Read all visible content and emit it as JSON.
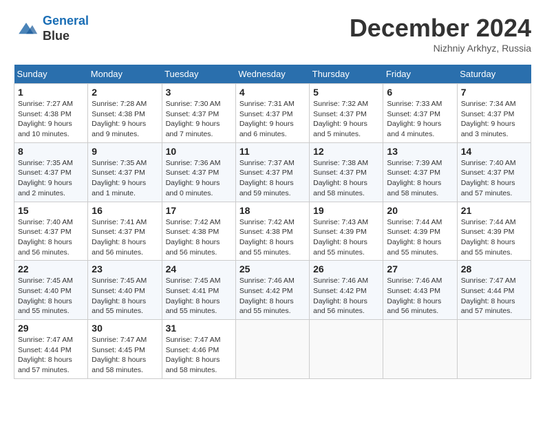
{
  "header": {
    "logo_line1": "General",
    "logo_line2": "Blue",
    "month": "December 2024",
    "location": "Nizhniy Arkhyz, Russia"
  },
  "weekdays": [
    "Sunday",
    "Monday",
    "Tuesday",
    "Wednesday",
    "Thursday",
    "Friday",
    "Saturday"
  ],
  "weeks": [
    [
      {
        "day": "1",
        "sunrise": "Sunrise: 7:27 AM",
        "sunset": "Sunset: 4:38 PM",
        "daylight": "Daylight: 9 hours and 10 minutes."
      },
      {
        "day": "2",
        "sunrise": "Sunrise: 7:28 AM",
        "sunset": "Sunset: 4:38 PM",
        "daylight": "Daylight: 9 hours and 9 minutes."
      },
      {
        "day": "3",
        "sunrise": "Sunrise: 7:30 AM",
        "sunset": "Sunset: 4:37 PM",
        "daylight": "Daylight: 9 hours and 7 minutes."
      },
      {
        "day": "4",
        "sunrise": "Sunrise: 7:31 AM",
        "sunset": "Sunset: 4:37 PM",
        "daylight": "Daylight: 9 hours and 6 minutes."
      },
      {
        "day": "5",
        "sunrise": "Sunrise: 7:32 AM",
        "sunset": "Sunset: 4:37 PM",
        "daylight": "Daylight: 9 hours and 5 minutes."
      },
      {
        "day": "6",
        "sunrise": "Sunrise: 7:33 AM",
        "sunset": "Sunset: 4:37 PM",
        "daylight": "Daylight: 9 hours and 4 minutes."
      },
      {
        "day": "7",
        "sunrise": "Sunrise: 7:34 AM",
        "sunset": "Sunset: 4:37 PM",
        "daylight": "Daylight: 9 hours and 3 minutes."
      }
    ],
    [
      {
        "day": "8",
        "sunrise": "Sunrise: 7:35 AM",
        "sunset": "Sunset: 4:37 PM",
        "daylight": "Daylight: 9 hours and 2 minutes."
      },
      {
        "day": "9",
        "sunrise": "Sunrise: 7:35 AM",
        "sunset": "Sunset: 4:37 PM",
        "daylight": "Daylight: 9 hours and 1 minute."
      },
      {
        "day": "10",
        "sunrise": "Sunrise: 7:36 AM",
        "sunset": "Sunset: 4:37 PM",
        "daylight": "Daylight: 9 hours and 0 minutes."
      },
      {
        "day": "11",
        "sunrise": "Sunrise: 7:37 AM",
        "sunset": "Sunset: 4:37 PM",
        "daylight": "Daylight: 8 hours and 59 minutes."
      },
      {
        "day": "12",
        "sunrise": "Sunrise: 7:38 AM",
        "sunset": "Sunset: 4:37 PM",
        "daylight": "Daylight: 8 hours and 58 minutes."
      },
      {
        "day": "13",
        "sunrise": "Sunrise: 7:39 AM",
        "sunset": "Sunset: 4:37 PM",
        "daylight": "Daylight: 8 hours and 58 minutes."
      },
      {
        "day": "14",
        "sunrise": "Sunrise: 7:40 AM",
        "sunset": "Sunset: 4:37 PM",
        "daylight": "Daylight: 8 hours and 57 minutes."
      }
    ],
    [
      {
        "day": "15",
        "sunrise": "Sunrise: 7:40 AM",
        "sunset": "Sunset: 4:37 PM",
        "daylight": "Daylight: 8 hours and 56 minutes."
      },
      {
        "day": "16",
        "sunrise": "Sunrise: 7:41 AM",
        "sunset": "Sunset: 4:37 PM",
        "daylight": "Daylight: 8 hours and 56 minutes."
      },
      {
        "day": "17",
        "sunrise": "Sunrise: 7:42 AM",
        "sunset": "Sunset: 4:38 PM",
        "daylight": "Daylight: 8 hours and 56 minutes."
      },
      {
        "day": "18",
        "sunrise": "Sunrise: 7:42 AM",
        "sunset": "Sunset: 4:38 PM",
        "daylight": "Daylight: 8 hours and 55 minutes."
      },
      {
        "day": "19",
        "sunrise": "Sunrise: 7:43 AM",
        "sunset": "Sunset: 4:39 PM",
        "daylight": "Daylight: 8 hours and 55 minutes."
      },
      {
        "day": "20",
        "sunrise": "Sunrise: 7:44 AM",
        "sunset": "Sunset: 4:39 PM",
        "daylight": "Daylight: 8 hours and 55 minutes."
      },
      {
        "day": "21",
        "sunrise": "Sunrise: 7:44 AM",
        "sunset": "Sunset: 4:39 PM",
        "daylight": "Daylight: 8 hours and 55 minutes."
      }
    ],
    [
      {
        "day": "22",
        "sunrise": "Sunrise: 7:45 AM",
        "sunset": "Sunset: 4:40 PM",
        "daylight": "Daylight: 8 hours and 55 minutes."
      },
      {
        "day": "23",
        "sunrise": "Sunrise: 7:45 AM",
        "sunset": "Sunset: 4:40 PM",
        "daylight": "Daylight: 8 hours and 55 minutes."
      },
      {
        "day": "24",
        "sunrise": "Sunrise: 7:45 AM",
        "sunset": "Sunset: 4:41 PM",
        "daylight": "Daylight: 8 hours and 55 minutes."
      },
      {
        "day": "25",
        "sunrise": "Sunrise: 7:46 AM",
        "sunset": "Sunset: 4:42 PM",
        "daylight": "Daylight: 8 hours and 55 minutes."
      },
      {
        "day": "26",
        "sunrise": "Sunrise: 7:46 AM",
        "sunset": "Sunset: 4:42 PM",
        "daylight": "Daylight: 8 hours and 56 minutes."
      },
      {
        "day": "27",
        "sunrise": "Sunrise: 7:46 AM",
        "sunset": "Sunset: 4:43 PM",
        "daylight": "Daylight: 8 hours and 56 minutes."
      },
      {
        "day": "28",
        "sunrise": "Sunrise: 7:47 AM",
        "sunset": "Sunset: 4:44 PM",
        "daylight": "Daylight: 8 hours and 57 minutes."
      }
    ],
    [
      {
        "day": "29",
        "sunrise": "Sunrise: 7:47 AM",
        "sunset": "Sunset: 4:44 PM",
        "daylight": "Daylight: 8 hours and 57 minutes."
      },
      {
        "day": "30",
        "sunrise": "Sunrise: 7:47 AM",
        "sunset": "Sunset: 4:45 PM",
        "daylight": "Daylight: 8 hours and 58 minutes."
      },
      {
        "day": "31",
        "sunrise": "Sunrise: 7:47 AM",
        "sunset": "Sunset: 4:46 PM",
        "daylight": "Daylight: 8 hours and 58 minutes."
      },
      null,
      null,
      null,
      null
    ]
  ]
}
